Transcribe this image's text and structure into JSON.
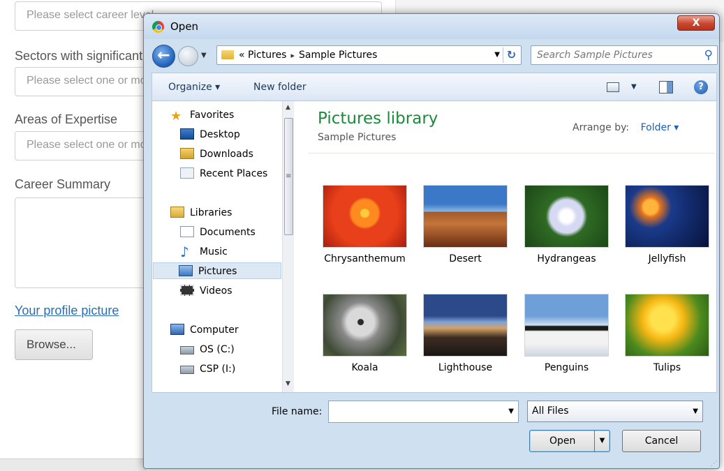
{
  "background_form": {
    "career_level_placeholder": "Please select career level",
    "sectors_label": "Sectors with significant experience",
    "sectors_placeholder": "Please select one or more",
    "expertise_label": "Areas of Expertise",
    "expertise_placeholder": "Please select one or more",
    "summary_label": "Career Summary",
    "profile_picture_link": "Your profile picture",
    "browse_button": "Browse..."
  },
  "dialog": {
    "title": "Open",
    "close_symbol": "X",
    "breadcrumb": {
      "prefix": "«",
      "parts": [
        "Pictures",
        "Sample Pictures"
      ],
      "separator": "▸"
    },
    "search_placeholder": "Search Sample Pictures",
    "toolbar": {
      "organize": "Organize ▾",
      "new_folder": "New folder"
    },
    "nav": {
      "favorites": "Favorites",
      "desktop": "Desktop",
      "downloads": "Downloads",
      "recent_places": "Recent Places",
      "libraries": "Libraries",
      "documents": "Documents",
      "music": "Music",
      "pictures": "Pictures",
      "videos": "Videos",
      "computer": "Computer",
      "os_drive": "OS (C:)",
      "csp_drive": "CSP (I:)"
    },
    "library": {
      "title": "Pictures library",
      "subtitle": "Sample Pictures",
      "arrange_label": "Arrange by:",
      "arrange_value": "Folder ▾"
    },
    "files": [
      "Chrysanthemum",
      "Desert",
      "Hydrangeas",
      "Jellyfish",
      "Koala",
      "Lighthouse",
      "Penguins",
      "Tulips"
    ],
    "bottom": {
      "file_name_label": "File name:",
      "file_name_value": "",
      "filter_value": "All Files",
      "open_button": "Open",
      "cancel_button": "Cancel"
    }
  }
}
